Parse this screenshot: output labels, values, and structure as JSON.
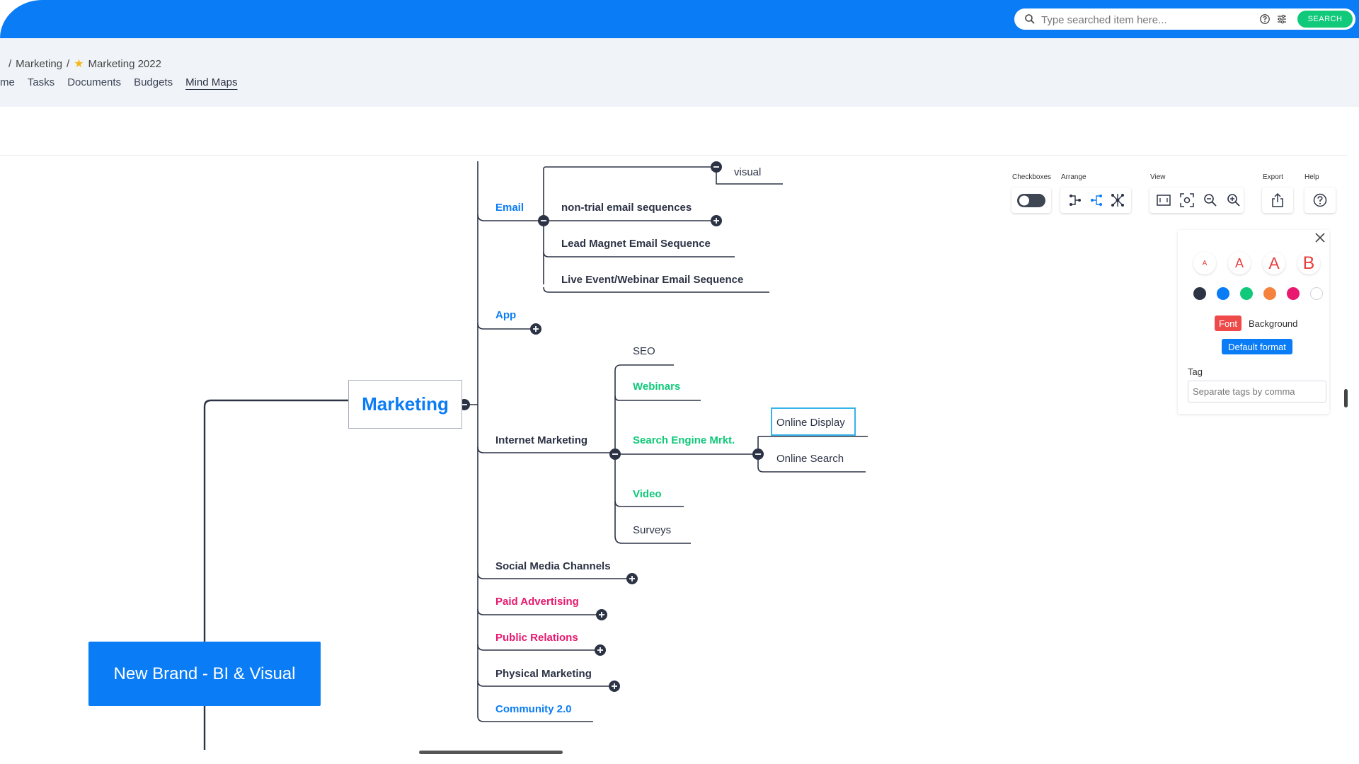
{
  "search": {
    "placeholder": "Type searched item here...",
    "button_label": "SEARCH"
  },
  "breadcrumb": {
    "separator1": "/",
    "parent": "Marketing",
    "separator2": "/",
    "current": "Marketing 2022"
  },
  "tabs": [
    {
      "label": "me"
    },
    {
      "label": "Tasks"
    },
    {
      "label": "Documents"
    },
    {
      "label": "Budgets"
    },
    {
      "label": "Mind Maps",
      "active": true
    }
  ],
  "mindmap": {
    "root": "New Brand - BI & Visual",
    "main": "Marketing",
    "branches": {
      "email": "Email",
      "app": "App",
      "internet": "Internet Marketing",
      "social": "Social Media Channels",
      "paid": "Paid Advertising",
      "pr": "Public Relations",
      "physical": "Physical Marketing",
      "community": "Community 2.0"
    },
    "email_children": {
      "visual": "visual",
      "nontrial": "non-trial email sequences",
      "leadmagnet": "Lead Magnet Email Sequence",
      "liveevent": "Live Event/Webinar Email Sequence"
    },
    "internet_children": {
      "seo": "SEO",
      "webinars": "Webinars",
      "sem": "Search Engine Mrkt.",
      "video": "Video",
      "surveys": "Surveys"
    },
    "sem_children": {
      "display": "Online Display",
      "search": "Online Search"
    }
  },
  "toolbar": {
    "checkboxes_label": "Checkboxes",
    "arrange_label": "Arrange",
    "view_label": "View",
    "export_label": "Export",
    "help_label": "Help"
  },
  "format_panel": {
    "font_sizes": [
      "A",
      "A",
      "A",
      "B"
    ],
    "colors": [
      "#2c3345",
      "#0a7cf5",
      "#10c97a",
      "#f5833d",
      "#e8196e",
      "#ffffff"
    ],
    "font_tab": "Font",
    "background_tab": "Background",
    "default_format": "Default format",
    "tag_label": "Tag",
    "tag_placeholder": "Separate tags by comma"
  },
  "colors": {
    "accent": "#0a7cf5",
    "green": "#10c97a",
    "pink": "#e8196e",
    "dark": "#2c3345"
  }
}
